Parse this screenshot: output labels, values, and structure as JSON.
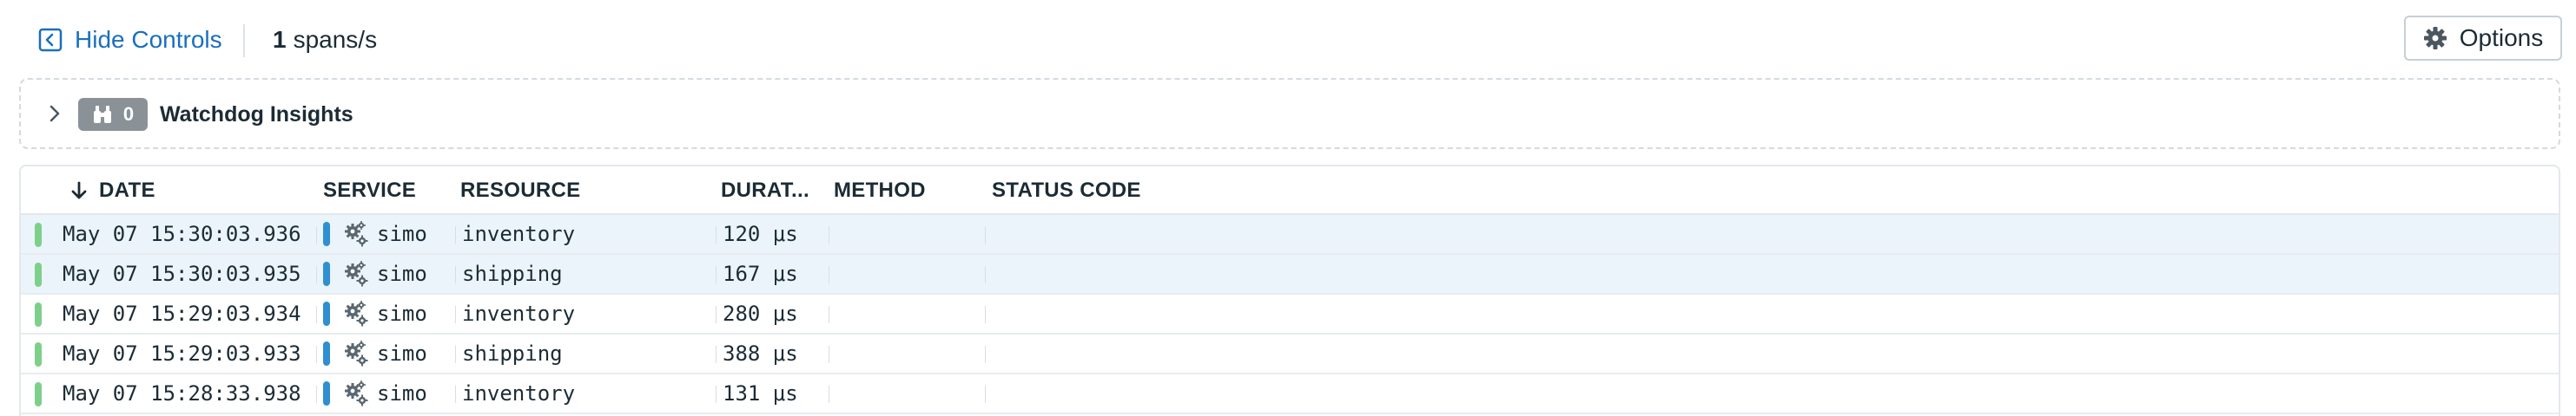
{
  "toolbar": {
    "hide_controls_label": "Hide Controls",
    "hide_controls_icon": "collapse-panel-icon",
    "rate_value": "1",
    "rate_unit": "spans/s",
    "options_label": "Options",
    "options_icon": "gear-icon"
  },
  "watchdog": {
    "expand_icon": "chevron-right-icon",
    "badge_icon": "binoculars-icon",
    "badge_count": "0",
    "title": "Watchdog Insights"
  },
  "table": {
    "sort_icon": "arrow-down-icon",
    "columns": {
      "date": "DATE",
      "service": "SERVICE",
      "resource": "RESOURCE",
      "duration": "DURAT...",
      "method": "METHOD",
      "status_code": "STATUS CODE"
    },
    "rows": [
      {
        "date": "May 07 15:30:03.936",
        "service": "simo",
        "resource": "inventory",
        "duration": "120 μs",
        "method": "",
        "status_code": "",
        "highlighted": true
      },
      {
        "date": "May 07 15:30:03.935",
        "service": "simo",
        "resource": "shipping",
        "duration": "167 μs",
        "method": "",
        "status_code": "",
        "highlighted": true
      },
      {
        "date": "May 07 15:29:03.934",
        "service": "simo",
        "resource": "inventory",
        "duration": "280 μs",
        "method": "",
        "status_code": "",
        "highlighted": false
      },
      {
        "date": "May 07 15:29:03.933",
        "service": "simo",
        "resource": "shipping",
        "duration": "388 μs",
        "method": "",
        "status_code": "",
        "highlighted": false
      },
      {
        "date": "May 07 15:28:33.938",
        "service": "simo",
        "resource": "inventory",
        "duration": "131 μs",
        "method": "",
        "status_code": "",
        "highlighted": false
      }
    ],
    "row_status_icon": "status-ok-bar",
    "service_icon": "gears-icon"
  },
  "colors": {
    "link": "#1a6fbf",
    "status_ok": "#7dd08a",
    "service_bar": "#2f8fd0",
    "row_highlight": "#ebf4fb",
    "badge_bg": "#8a9298"
  }
}
